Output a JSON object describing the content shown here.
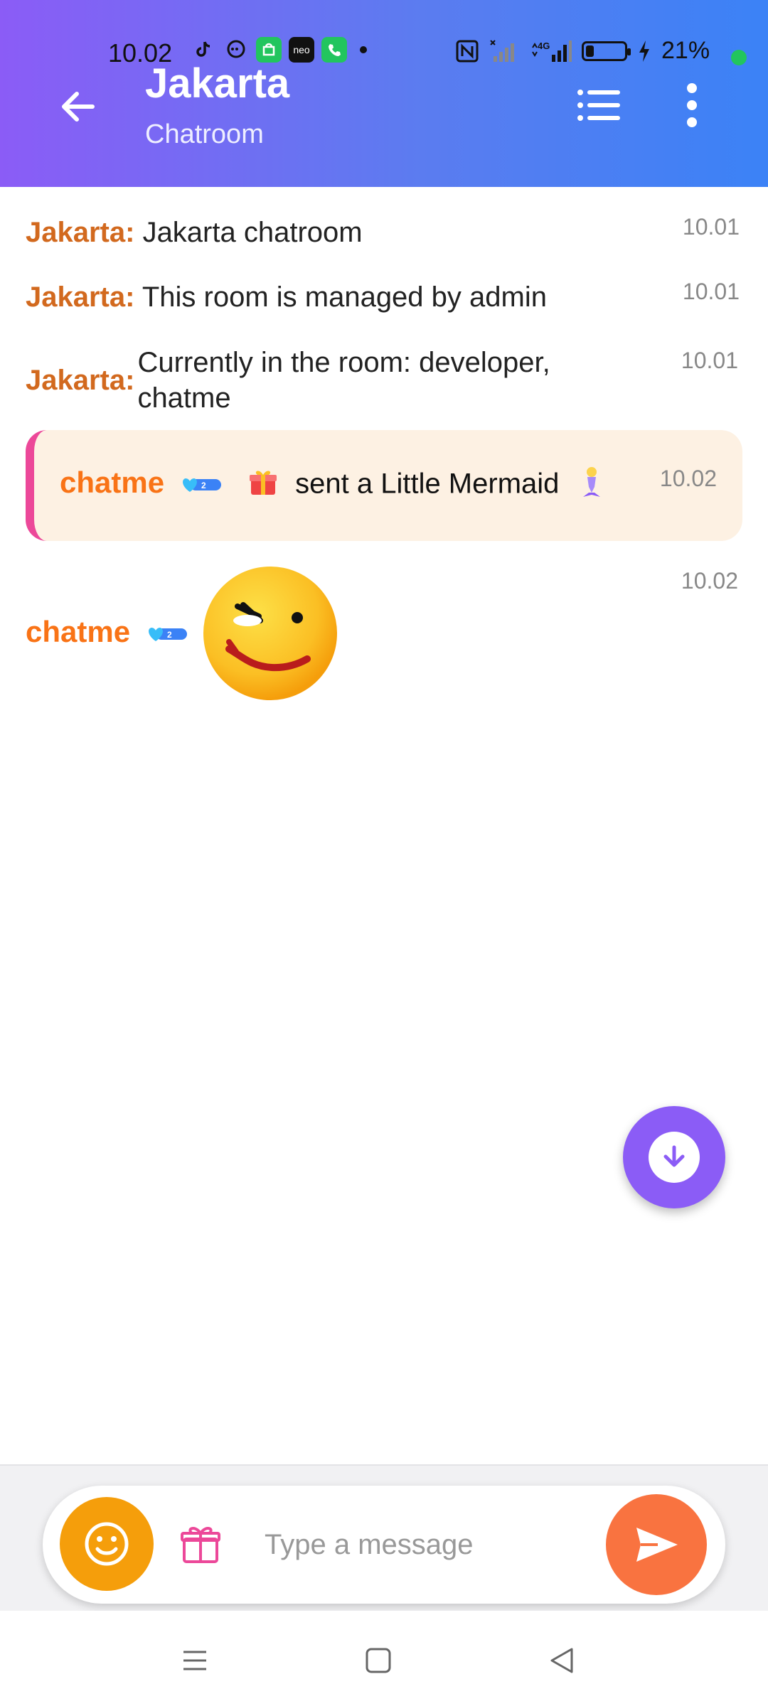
{
  "status_bar": {
    "time": "10.02",
    "battery": "21%",
    "battery_level": 0.21,
    "network": "4G"
  },
  "header": {
    "title": "Jakarta",
    "subtitle": "Chatroom"
  },
  "messages": [
    {
      "sender": "Jakarta:",
      "text": "Jakarta chatroom",
      "time": "10.01"
    },
    {
      "sender": "Jakarta:",
      "text": "This room is managed by admin",
      "time": "10.01"
    },
    {
      "sender": "Jakarta:",
      "text": "Currently in the room: developer, chatme",
      "time": "10.01"
    }
  ],
  "gift_message": {
    "sender": "chatme",
    "badge_icon": "heart-badge-icon",
    "text": "sent a Little Mermaid",
    "time": "10.02"
  },
  "sticker_message": {
    "sender": "chatme",
    "separator": ":",
    "sticker_icon": "wink-smile-sticker",
    "time": "10.02"
  },
  "composer": {
    "placeholder": "Type a message"
  },
  "colors": {
    "header_start": "#8b5cf6",
    "header_end": "#3b82f6",
    "sender": "#d2691e",
    "sender_user": "#f97316",
    "gift_bg": "#fdf1e3",
    "gift_border": "#ec4899",
    "fab": "#8b5cf6",
    "emoji_btn": "#f59e0b",
    "send_btn": "#f97340"
  }
}
